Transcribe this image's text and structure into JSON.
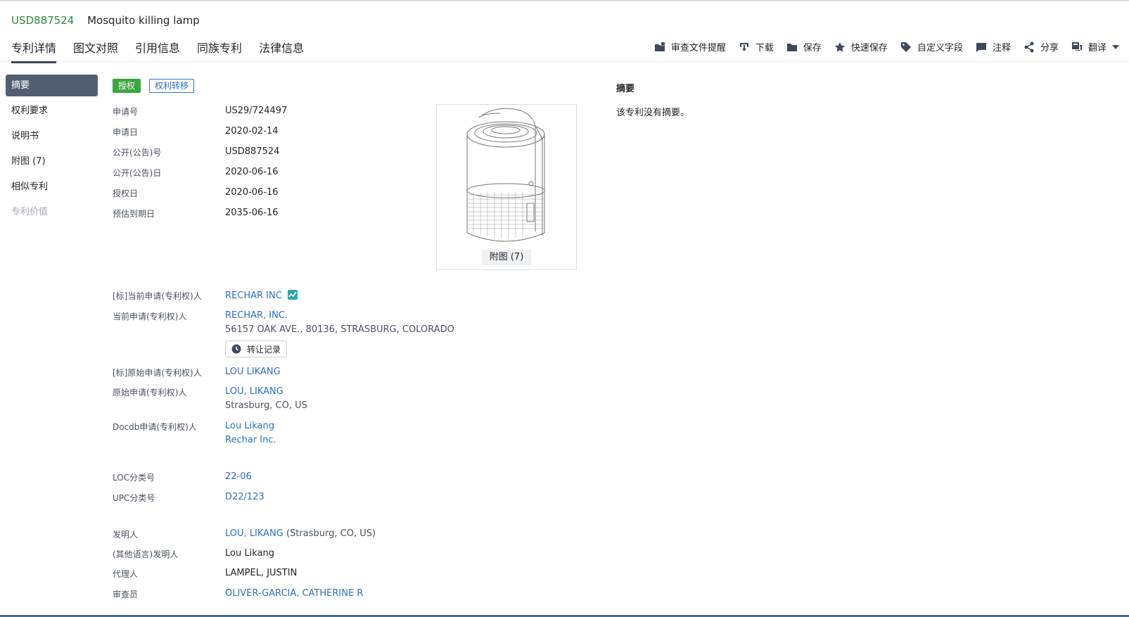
{
  "header": {
    "patent_number": "USD887524",
    "title": "Mosquito killing lamp"
  },
  "tabs": [
    "专利详情",
    "图文对照",
    "引用信息",
    "同族专利",
    "法律信息"
  ],
  "toolbar": {
    "exam_reminder": "审查文件提醒",
    "download": "下载",
    "save": "保存",
    "quick_save": "快速保存",
    "custom_field": "自定义字段",
    "annotate": "注释",
    "share": "分享",
    "translate": "翻译"
  },
  "sidenav": {
    "items": [
      {
        "label": "摘要"
      },
      {
        "label": "权利要求"
      },
      {
        "label": "说明书"
      },
      {
        "label": "附图 (7)"
      },
      {
        "label": "相似专利"
      },
      {
        "label": "专利价值"
      }
    ]
  },
  "badges": {
    "status": "授权",
    "transfer": "权利转移"
  },
  "biblio": {
    "app_no": {
      "label": "申请号",
      "value": "US29/724497"
    },
    "app_date": {
      "label": "申请日",
      "value": "2020-02-14"
    },
    "pub_no": {
      "label": "公开(公告)号",
      "value": "USD887524"
    },
    "pub_date": {
      "label": "公开(公告)日",
      "value": "2020-06-16"
    },
    "grant_date": {
      "label": "授权日",
      "value": "2020-06-16"
    },
    "expiry": {
      "label": "预估到期日",
      "value": "2035-06-16"
    }
  },
  "figure": {
    "caption": "附图 (7)"
  },
  "applicants": {
    "std_current": {
      "label": "[标]当前申请(专利权)人",
      "value": "RECHAR INC"
    },
    "current": {
      "label": "当前申请(专利权)人",
      "value": "RECHAR, INC.",
      "address": "56157 OAK AVE., 80136, STRASBURG, COLORADO",
      "transfer_btn": "转让记录"
    },
    "std_original": {
      "label": "[标]原始申请(专利权)人",
      "value": "LOU LIKANG"
    },
    "original": {
      "label": "原始申请(专利权)人",
      "value": "LOU, LIKANG",
      "address": "Strasburg, CO, US"
    },
    "docdb": {
      "label": "Docdb申请(专利权)人",
      "value1": "Lou Likang",
      "value2": "Rechar Inc."
    }
  },
  "classification": {
    "loc": {
      "label": "LOC分类号",
      "value": "22-06"
    },
    "upc": {
      "label": "UPC分类号",
      "value": "D22/123"
    }
  },
  "people": {
    "inventor": {
      "label": "发明人",
      "value": "LOU, LIKANG",
      "location": "(Strasburg, CO, US)"
    },
    "inventor_other": {
      "label": "(其他语言)发明人",
      "value": "Lou Likang"
    },
    "agent": {
      "label": "代理人",
      "value": "LAMPEL, JUSTIN"
    },
    "examiner": {
      "label": "审查员",
      "value": "OLIVER-GARCIA, CATHERINE R"
    }
  },
  "abstract": {
    "title": "摘要",
    "text": "该专利没有摘要。"
  }
}
